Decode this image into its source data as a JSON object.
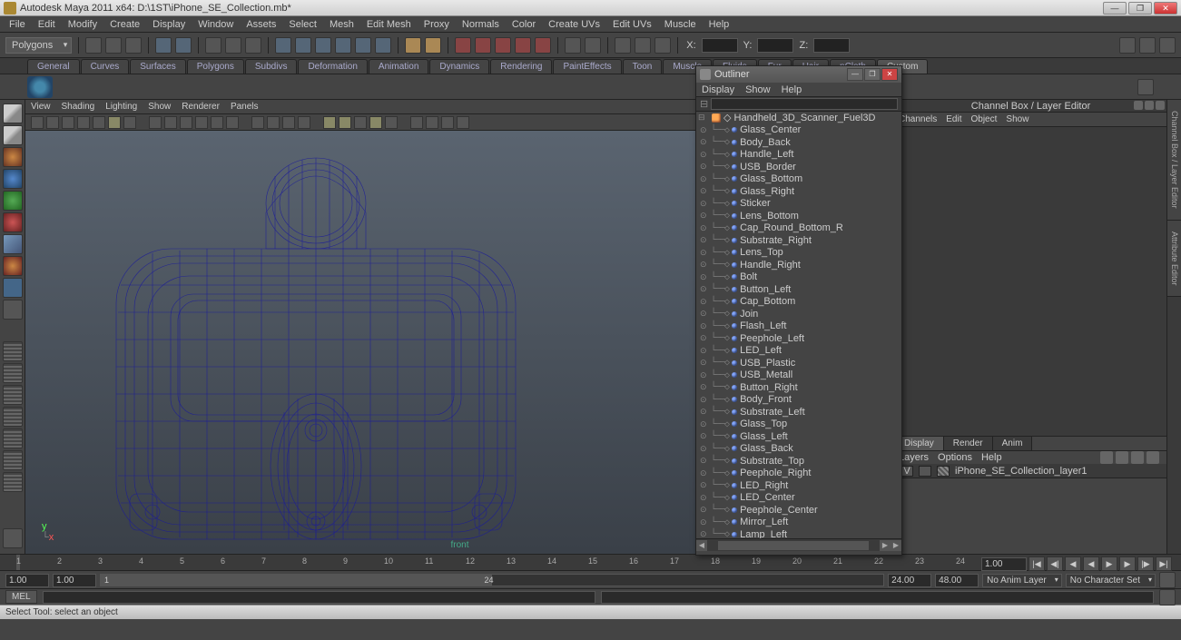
{
  "app": {
    "title": "Autodesk Maya 2011 x64: D:\\1ST\\iPhone_SE_Collection.mb*"
  },
  "menu": [
    "File",
    "Edit",
    "Modify",
    "Create",
    "Display",
    "Window",
    "Assets",
    "Select",
    "Mesh",
    "Edit Mesh",
    "Proxy",
    "Normals",
    "Color",
    "Create UVs",
    "Edit UVs",
    "Muscle",
    "Help"
  ],
  "mode_dropdown": "Polygons",
  "coords": {
    "x": "X:",
    "y": "Y:",
    "z": "Z:"
  },
  "shelf_tabs": [
    "General",
    "Curves",
    "Surfaces",
    "Polygons",
    "Subdivs",
    "Deformation",
    "Animation",
    "Dynamics",
    "Rendering",
    "PaintEffects",
    "Toon",
    "Muscle",
    "Fluids",
    "Fur",
    "Hair",
    "nCloth",
    "Custom"
  ],
  "shelf_active_idx": 16,
  "viewport_menu": [
    "View",
    "Shading",
    "Lighting",
    "Show",
    "Renderer",
    "Panels"
  ],
  "viewport_label": "front",
  "axis": {
    "y": "y",
    "x": "x"
  },
  "right_panel": {
    "title": "Channel Box / Layer Editor",
    "tabs": [
      "Channels",
      "Edit",
      "Object",
      "Show"
    ],
    "lower_tabs": [
      "Display",
      "Render",
      "Anim"
    ],
    "lower_menu": [
      "Layers",
      "Options",
      "Help"
    ],
    "layer": {
      "vis": "V",
      "name": "iPhone_SE_Collection_layer1"
    }
  },
  "side_tabs": [
    "Channel Box / Layer Editor",
    "Attribute Editor"
  ],
  "outliner": {
    "title": "Outliner",
    "menu": [
      "Display",
      "Show",
      "Help"
    ],
    "search_placeholder": "",
    "root": "Handheld_3D_Scanner_Fuel3D",
    "items": [
      "Glass_Center",
      "Body_Back",
      "Handle_Left",
      "USB_Border",
      "Glass_Bottom",
      "Glass_Right",
      "Sticker",
      "Lens_Bottom",
      "Cap_Round_Bottom_R",
      "Substrate_Right",
      "Lens_Top",
      "Handle_Right",
      "Bolt",
      "Button_Left",
      "Cap_Bottom",
      "Join",
      "Flash_Left",
      "Peephole_Left",
      "LED_Left",
      "USB_Plastic",
      "USB_Metall",
      "Button_Right",
      "Body_Front",
      "Substrate_Left",
      "Glass_Top",
      "Glass_Left",
      "Glass_Back",
      "Substrate_Top",
      "Peephole_Right",
      "LED_Right",
      "LED_Center",
      "Peephole_Center",
      "Mirror_Left",
      "Lamp_Left"
    ]
  },
  "timeline": {
    "ticks": [
      "1",
      "2",
      "3",
      "4",
      "5",
      "6",
      "7",
      "8",
      "9",
      "10",
      "11",
      "12",
      "13",
      "14",
      "15",
      "16",
      "17",
      "18",
      "19",
      "20",
      "21",
      "22",
      "23",
      "24"
    ],
    "start1": "1.00",
    "start2": "1.00",
    "slider_left": "1",
    "slider_right": "24",
    "end1": "24.00",
    "end2": "48.00",
    "cur": "1.00",
    "anim_layer": "No Anim Layer",
    "char_set": "No Character Set"
  },
  "mel": {
    "label": "MEL"
  },
  "status": "Select Tool: select an object"
}
